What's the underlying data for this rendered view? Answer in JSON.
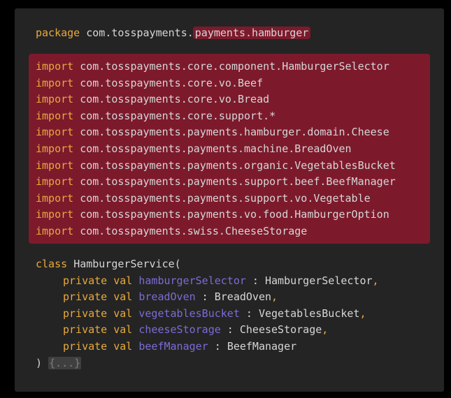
{
  "code": {
    "package_line": {
      "keyword": "package",
      "name": "com.tosspayments.",
      "highlighted": "payments.hamburger"
    },
    "imports": [
      {
        "keyword": "import",
        "path": "com.tosspayments.core.component.HamburgerSelector"
      },
      {
        "keyword": "import",
        "path": "com.tosspayments.core.vo.Beef"
      },
      {
        "keyword": "import",
        "path": "com.tosspayments.core.vo.Bread"
      },
      {
        "keyword": "import",
        "path": "com.tosspayments.core.support.*"
      },
      {
        "keyword": "import",
        "path": "com.tosspayments.payments.hamburger.domain.Cheese"
      },
      {
        "keyword": "import",
        "path": "com.tosspayments.payments.machine.BreadOven"
      },
      {
        "keyword": "import",
        "path": "com.tosspayments.payments.organic.VegetablesBucket"
      },
      {
        "keyword": "import",
        "path": "com.tosspayments.payments.support.beef.BeefManager"
      },
      {
        "keyword": "import",
        "path": "com.tosspayments.payments.support.vo.Vegetable"
      },
      {
        "keyword": "import",
        "path": "com.tosspayments.payments.vo.food.HamburgerOption"
      },
      {
        "keyword": "import",
        "path": "com.tosspayments.swiss.CheeseStorage"
      }
    ],
    "class_decl": {
      "keyword": "class",
      "name": "HamburgerService("
    },
    "params": [
      {
        "modifier": "private",
        "val": "val",
        "name": "hamburgerSelector",
        "sep": " : ",
        "type": "HamburgerSelector",
        "comma": ","
      },
      {
        "modifier": "private",
        "val": "val",
        "name": "breadOven",
        "sep": " : ",
        "type": "BreadOven",
        "comma": ","
      },
      {
        "modifier": "private",
        "val": "val",
        "name": "vegetablesBucket",
        "sep": " : ",
        "type": "VegetablesBucket",
        "comma": ","
      },
      {
        "modifier": "private",
        "val": "val",
        "name": "cheeseStorage",
        "sep": " : ",
        "type": "CheeseStorage",
        "comma": ","
      },
      {
        "modifier": "private",
        "val": "val",
        "name": "beefManager",
        "sep": " : ",
        "type": "BeefManager",
        "comma": ""
      }
    ],
    "closing": {
      "paren": ")",
      "fold": "{...}"
    }
  },
  "colors": {
    "background": "#242424",
    "keyword": "#e9a93c",
    "property": "#7b6cd6",
    "highlight": "#7c1a2c",
    "text": "#d6d6d6"
  }
}
